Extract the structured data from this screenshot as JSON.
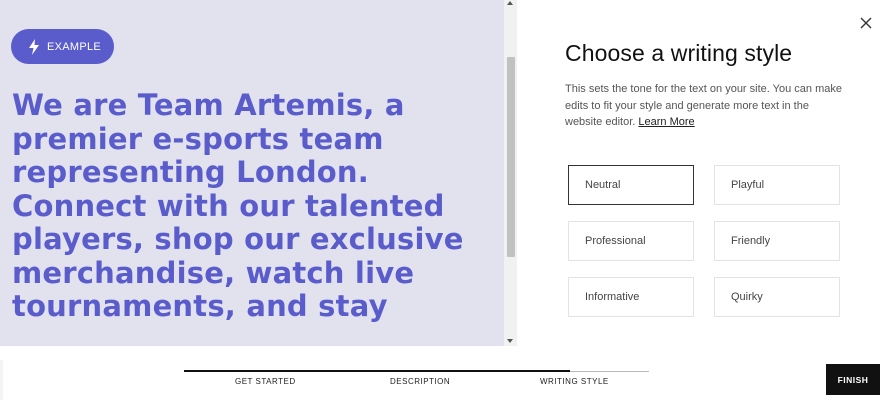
{
  "preview": {
    "badge_label": "EXAMPLE",
    "headline": "We are Team Artemis, a premier e-sports team representing London. Connect with our talented players, shop our exclusive merchandise, watch live tournaments, and stay"
  },
  "panel": {
    "title": "Choose a writing style",
    "description": "This sets the tone for the text on your site. You can make edits to fit your style and generate more text in the website editor.",
    "learn_more": "Learn More",
    "selected_style": "Neutral",
    "styles": [
      "Neutral",
      "Playful",
      "Professional",
      "Friendly",
      "Informative",
      "Quirky"
    ]
  },
  "footer": {
    "steps": [
      "GET STARTED",
      "DESCRIPTION",
      "WRITING STYLE"
    ],
    "current_step": 3,
    "total_steps": 3,
    "progress_fraction": 0.83,
    "finish_label": "FINISH"
  },
  "colors": {
    "accent": "#5a5ccc",
    "preview_background": "#e1e2ee",
    "finish_background": "#111111"
  },
  "icons": {
    "badge": "lightning-bolt-icon",
    "close": "close-icon"
  }
}
